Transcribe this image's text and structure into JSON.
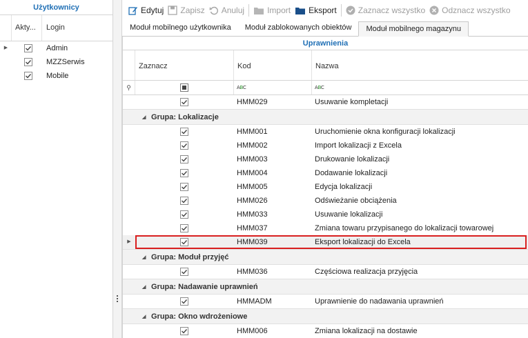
{
  "left": {
    "title": "Użytkownicy",
    "col_active": "Akty...",
    "col_login": "Login",
    "users": [
      {
        "login": "Admin",
        "active": true,
        "current": true
      },
      {
        "login": "MZZSerwis",
        "active": true,
        "current": false
      },
      {
        "login": "Mobile",
        "active": true,
        "current": false
      }
    ]
  },
  "toolbar": {
    "edit": "Edytuj",
    "save": "Zapisz",
    "cancel": "Anuluj",
    "import": "Import",
    "export": "Eksport",
    "select_all": "Zaznacz wszystko",
    "deselect_all": "Odznacz wszystko"
  },
  "tabs": [
    {
      "label": "Moduł mobilnego użytkownika",
      "active": false
    },
    {
      "label": "Moduł zablokowanych obiektów",
      "active": false
    },
    {
      "label": "Moduł mobilnego magazynu",
      "active": true
    }
  ],
  "grid": {
    "title": "Uprawnienia",
    "columns": {
      "select": "Zaznacz",
      "code": "Kod",
      "name": "Nazwa"
    },
    "top_row": {
      "code": "HMM029",
      "name": "Usuwanie kompletacji",
      "checked": true
    },
    "groups": [
      {
        "label": "Grupa: Lokalizacje",
        "rows": [
          {
            "code": "HMM001",
            "name": "Uruchomienie okna konfiguracji lokalizacji",
            "checked": true
          },
          {
            "code": "HMM002",
            "name": "Import lokalizacji z Excela",
            "checked": true
          },
          {
            "code": "HMM003",
            "name": "Drukowanie lokalizacji",
            "checked": true
          },
          {
            "code": "HMM004",
            "name": "Dodawanie lokalizacji",
            "checked": true
          },
          {
            "code": "HMM005",
            "name": "Edycja lokalizacji",
            "checked": true
          },
          {
            "code": "HMM026",
            "name": "Odświeżanie obciążenia",
            "checked": true
          },
          {
            "code": "HMM033",
            "name": "Usuwanie lokalizacji",
            "checked": true
          },
          {
            "code": "HMM037",
            "name": "Zmiana towaru przypisanego do lokalizacji towarowej",
            "checked": true
          },
          {
            "code": "HMM039",
            "name": "Eksport lokalizacji do Excela",
            "checked": true,
            "focused": true
          }
        ]
      },
      {
        "label": "Grupa: Moduł przyjęć",
        "rows": [
          {
            "code": "HMM036",
            "name": "Częściowa realizacja przyjęcia",
            "checked": true
          }
        ]
      },
      {
        "label": "Grupa: Nadawanie uprawnień",
        "rows": [
          {
            "code": "HMMADM",
            "name": "Uprawnienie do nadawania uprawnień",
            "checked": true
          }
        ]
      },
      {
        "label": "Grupa: Okno wdrożeniowe",
        "rows": [
          {
            "code": "HMM006",
            "name": "Zmiana lokalizacji na dostawie",
            "checked": true
          }
        ]
      }
    ]
  },
  "colors": {
    "accent": "#1f6fb5",
    "focus_border": "#d91e1e",
    "group_bg": "#f2f2f2"
  }
}
